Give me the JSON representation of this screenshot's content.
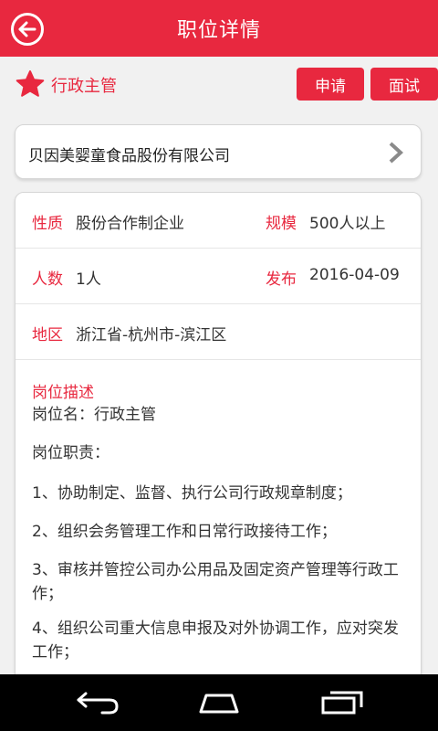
{
  "header": {
    "title": "职位详情"
  },
  "position": {
    "name": "行政主管"
  },
  "actions": {
    "apply_label": "申请",
    "interview_label": "面试"
  },
  "company": {
    "name": "贝因美婴童食品股份有限公司"
  },
  "details": {
    "nature_label": "性质",
    "nature_value": "股份合作制企业",
    "scale_label": "规模",
    "scale_value": "500人以上",
    "headcount_label": "人数",
    "headcount_value": "1人",
    "publish_label": "发布",
    "publish_value": "2016-04-09",
    "region_label": "地区",
    "region_value": "浙江省-杭州市-滨江区"
  },
  "description": {
    "title": "岗位描述",
    "lines": [
      "岗位名：行政主管",
      "岗位职责：",
      "1、协助制定、监督、执行公司行政规章制度；",
      "2、组织会务管理工作和日常行政接待工作；",
      "3、审核并管控公司办公用品及固定资产管理等行政工作；",
      "4、组织公司重大信息申报及对外协调工作，应对突发工作；"
    ]
  },
  "colors": {
    "accent": "#e8283f",
    "background": "#f1f1f1",
    "navbar": "#000000"
  }
}
